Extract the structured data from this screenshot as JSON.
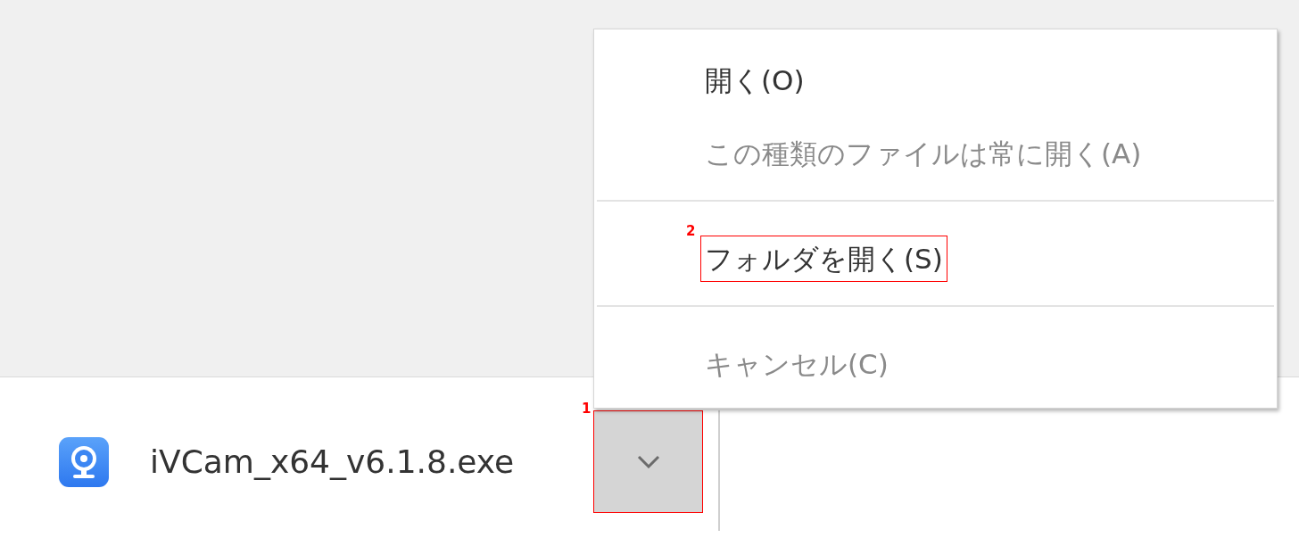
{
  "download_shelf": {
    "items": [
      {
        "file_name": "iVCam_x64_v6.1.8.exe",
        "menu_button": {
          "expanded": true,
          "callout": "1"
        }
      }
    ]
  },
  "context_menu": {
    "groups": [
      {
        "items": [
          {
            "label": "開く(O)",
            "disabled": false
          },
          {
            "label": "この種類のファイルは常に開く(A)",
            "disabled": true
          }
        ]
      },
      {
        "items": [
          {
            "label": "フォルダを開く(S)",
            "disabled": false,
            "callout": "2"
          }
        ]
      },
      {
        "items": [
          {
            "label": "キャンセル(C)",
            "disabled": true
          }
        ]
      }
    ]
  }
}
